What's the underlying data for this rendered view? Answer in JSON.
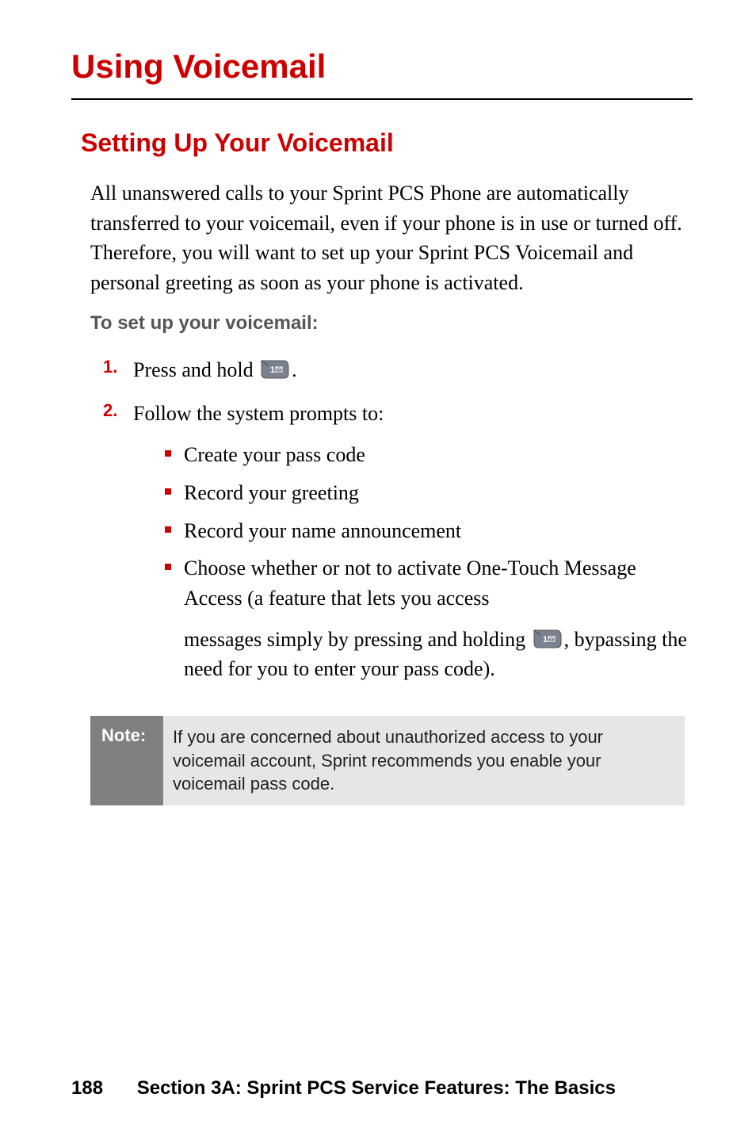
{
  "page": {
    "title": "Using Voicemail",
    "section_title": "Setting Up Your Voicemail",
    "intro": "All unanswered calls to your Sprint PCS Phone are automatically transferred to your voicemail, even if your phone is in use or turned off. Therefore, you will want to set up your Sprint PCS Voicemail and personal greeting as soon as your phone is activated.",
    "sub_heading": "To set up your voicemail:",
    "steps": [
      {
        "num": "1.",
        "text_pre": "Press and hold ",
        "icon": "key-1-icon",
        "text_post": "."
      },
      {
        "num": "2.",
        "text": "Follow the system prompts to:",
        "bullets": [
          {
            "text": "Create your pass code"
          },
          {
            "text": "Record your greeting"
          },
          {
            "text": "Record your name announcement"
          },
          {
            "text": "Choose whether or not to activate One-Touch Message Access (a feature that lets you access",
            "sub_pre": "messages simply by pressing and holding ",
            "sub_icon": "key-1-icon",
            "sub_post": ", bypassing the need for you to enter your pass code)."
          }
        ]
      }
    ],
    "note": {
      "label": "Note:",
      "text": "If you are concerned about unauthorized access to your voicemail account, Sprint recommends you enable your voicemail pass code."
    },
    "footer": {
      "page_number": "188",
      "section_text": "Section 3A: Sprint PCS Service Features: The Basics"
    }
  },
  "colors": {
    "accent": "#cc0000",
    "note_bg": "#e6e6e6",
    "note_label_bg": "#808080"
  }
}
